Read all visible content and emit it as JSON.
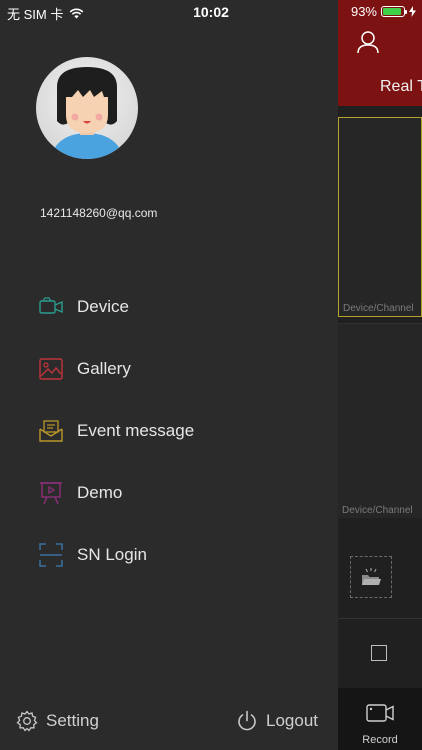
{
  "status_bar": {
    "carrier": "无 SIM 卡",
    "time": "10:02",
    "battery_percent": "93%",
    "battery_level": 0.93,
    "battery_color": "#3fd14a"
  },
  "drawer": {
    "email": "1421148260@qq.com",
    "menu": [
      {
        "label": "Device",
        "icon": "camera-icon",
        "color": "#2a9d8f"
      },
      {
        "label": "Gallery",
        "icon": "image-icon",
        "color": "#c0343b"
      },
      {
        "label": "Event message",
        "icon": "message-icon",
        "color": "#b8962b"
      },
      {
        "label": "Demo",
        "icon": "presentation-icon",
        "color": "#8c2f7a"
      },
      {
        "label": "SN Login",
        "icon": "scan-icon",
        "color": "#3b6f9e"
      }
    ],
    "setting_label": "Setting",
    "logout_label": "Logout"
  },
  "content": {
    "tab_label": "Real T",
    "pane_label_1": "Device/Channel",
    "pane_label_2": "Device/Channel",
    "record_label": "Record",
    "header_color": "#7d1212",
    "selected_border_color": "#b5a52a"
  }
}
